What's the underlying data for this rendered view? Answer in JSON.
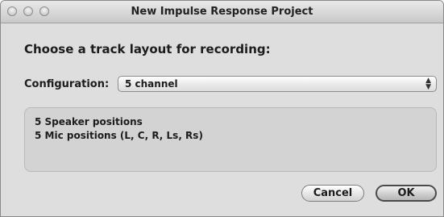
{
  "window": {
    "title": "New Impulse Response Project"
  },
  "dialog": {
    "heading": "Choose a track layout for recording:",
    "configuration_label": "Configuration:",
    "configuration_value": "5 channel",
    "info_lines": [
      "5 Speaker positions",
      "5 Mic positions (L, C, R, Ls, Rs)"
    ]
  },
  "buttons": {
    "cancel_label": "Cancel",
    "ok_label": "OK"
  },
  "icons": {
    "close": "close-icon",
    "minimize": "minimize-icon",
    "zoom": "zoom-icon",
    "popup_arrows": "updown-arrows-icon"
  }
}
